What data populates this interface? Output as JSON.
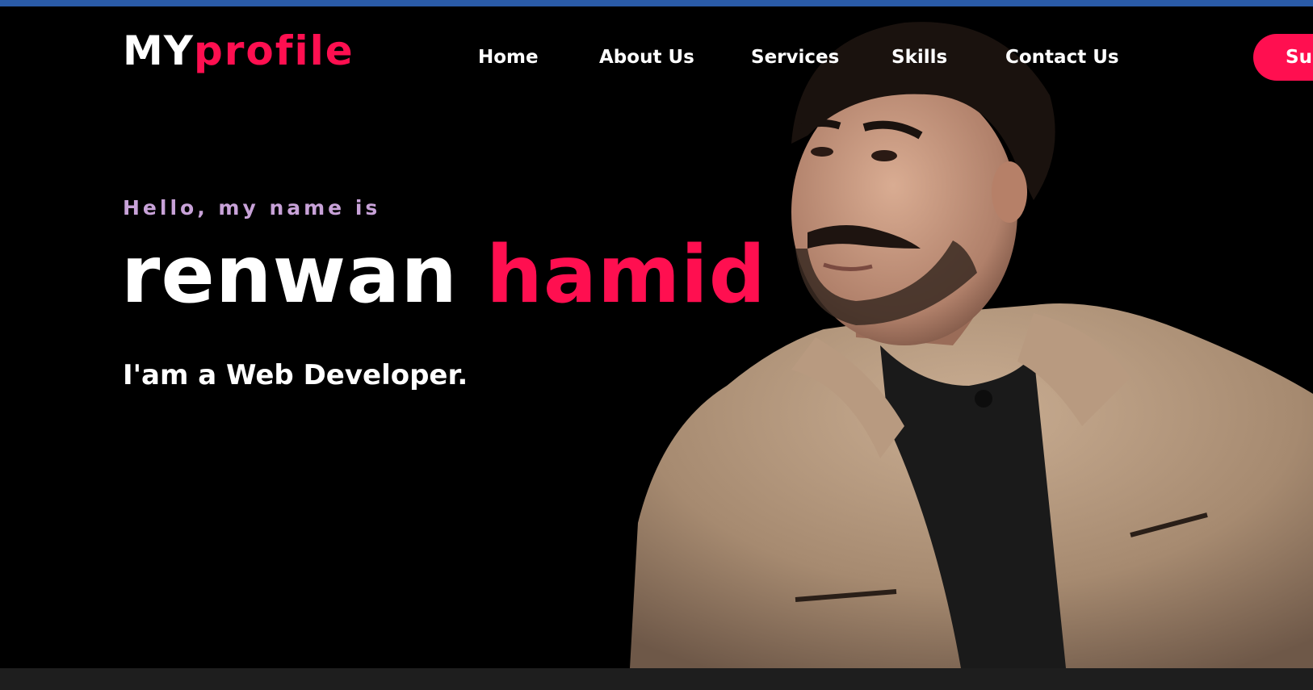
{
  "logo": {
    "my": "MY",
    "profile": "profile"
  },
  "nav": {
    "items": [
      {
        "label": "Home"
      },
      {
        "label": "About Us"
      },
      {
        "label": "Services"
      },
      {
        "label": "Skills"
      },
      {
        "label": "Contact Us"
      }
    ],
    "cta_label": "Subscribe"
  },
  "hero": {
    "greeting": "Hello, my name is",
    "first_name": "renwan",
    "last_name": "hamid",
    "tagline": "I'am a Web Developer."
  },
  "colors": {
    "accent": "#ff0f50",
    "greeting": "#c8a2d8",
    "background": "#000000",
    "browser_bar": "#2a5ba8"
  }
}
